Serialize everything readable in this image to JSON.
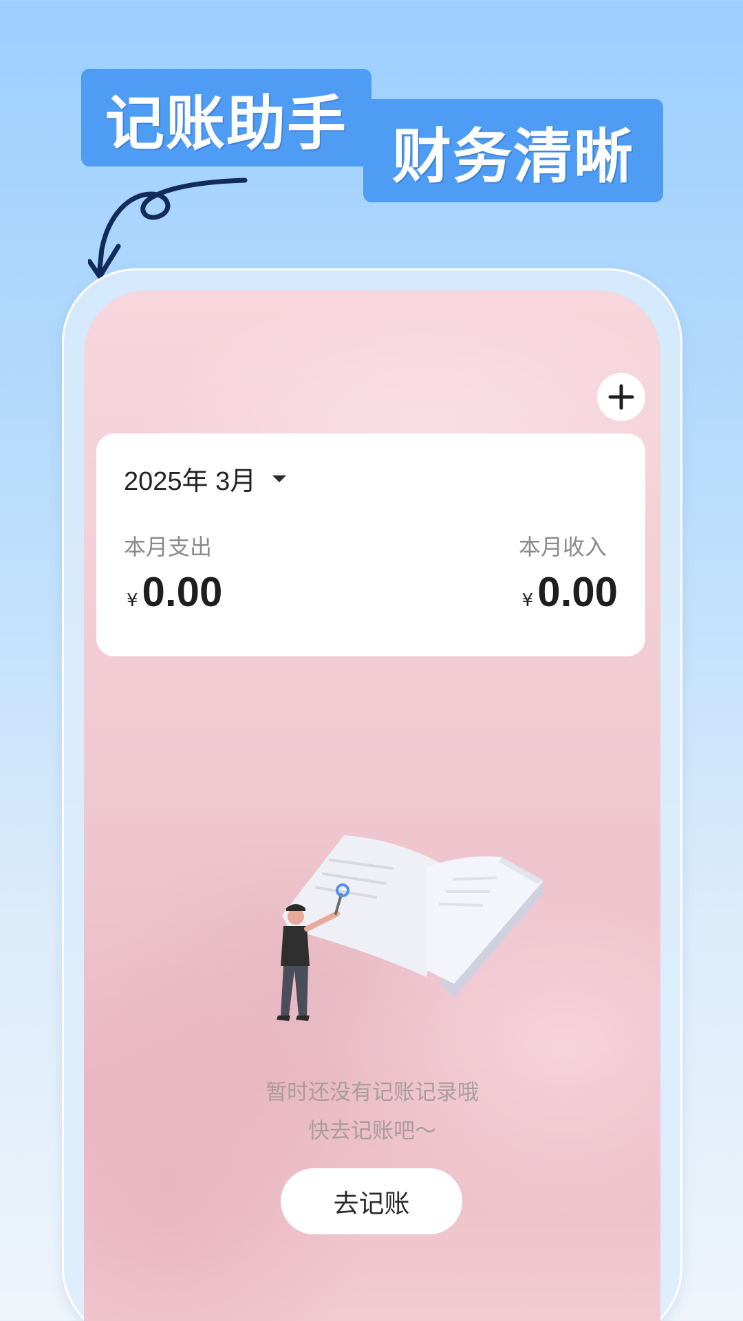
{
  "headline": {
    "badge_1": "记账助手",
    "badge_2": "财务清晰"
  },
  "header": {
    "add_icon": "plus-icon"
  },
  "summary": {
    "month": "2025年 3月",
    "dropdown_icon": "caret-down-icon",
    "expense": {
      "label": "本月支出",
      "currency": "¥",
      "amount": "0.00"
    },
    "income": {
      "label": "本月收入",
      "currency": "¥",
      "amount": "0.00"
    }
  },
  "empty_state": {
    "illustration": "person-reading-book-illustration",
    "line_1": "暂时还没有记账记录哦",
    "line_2": "快去记账吧～",
    "button_label": "去记账"
  },
  "colors": {
    "badge": "#4f9cf5",
    "background_top": "#9ccfff",
    "screen_pink": "#f0c9d1"
  }
}
